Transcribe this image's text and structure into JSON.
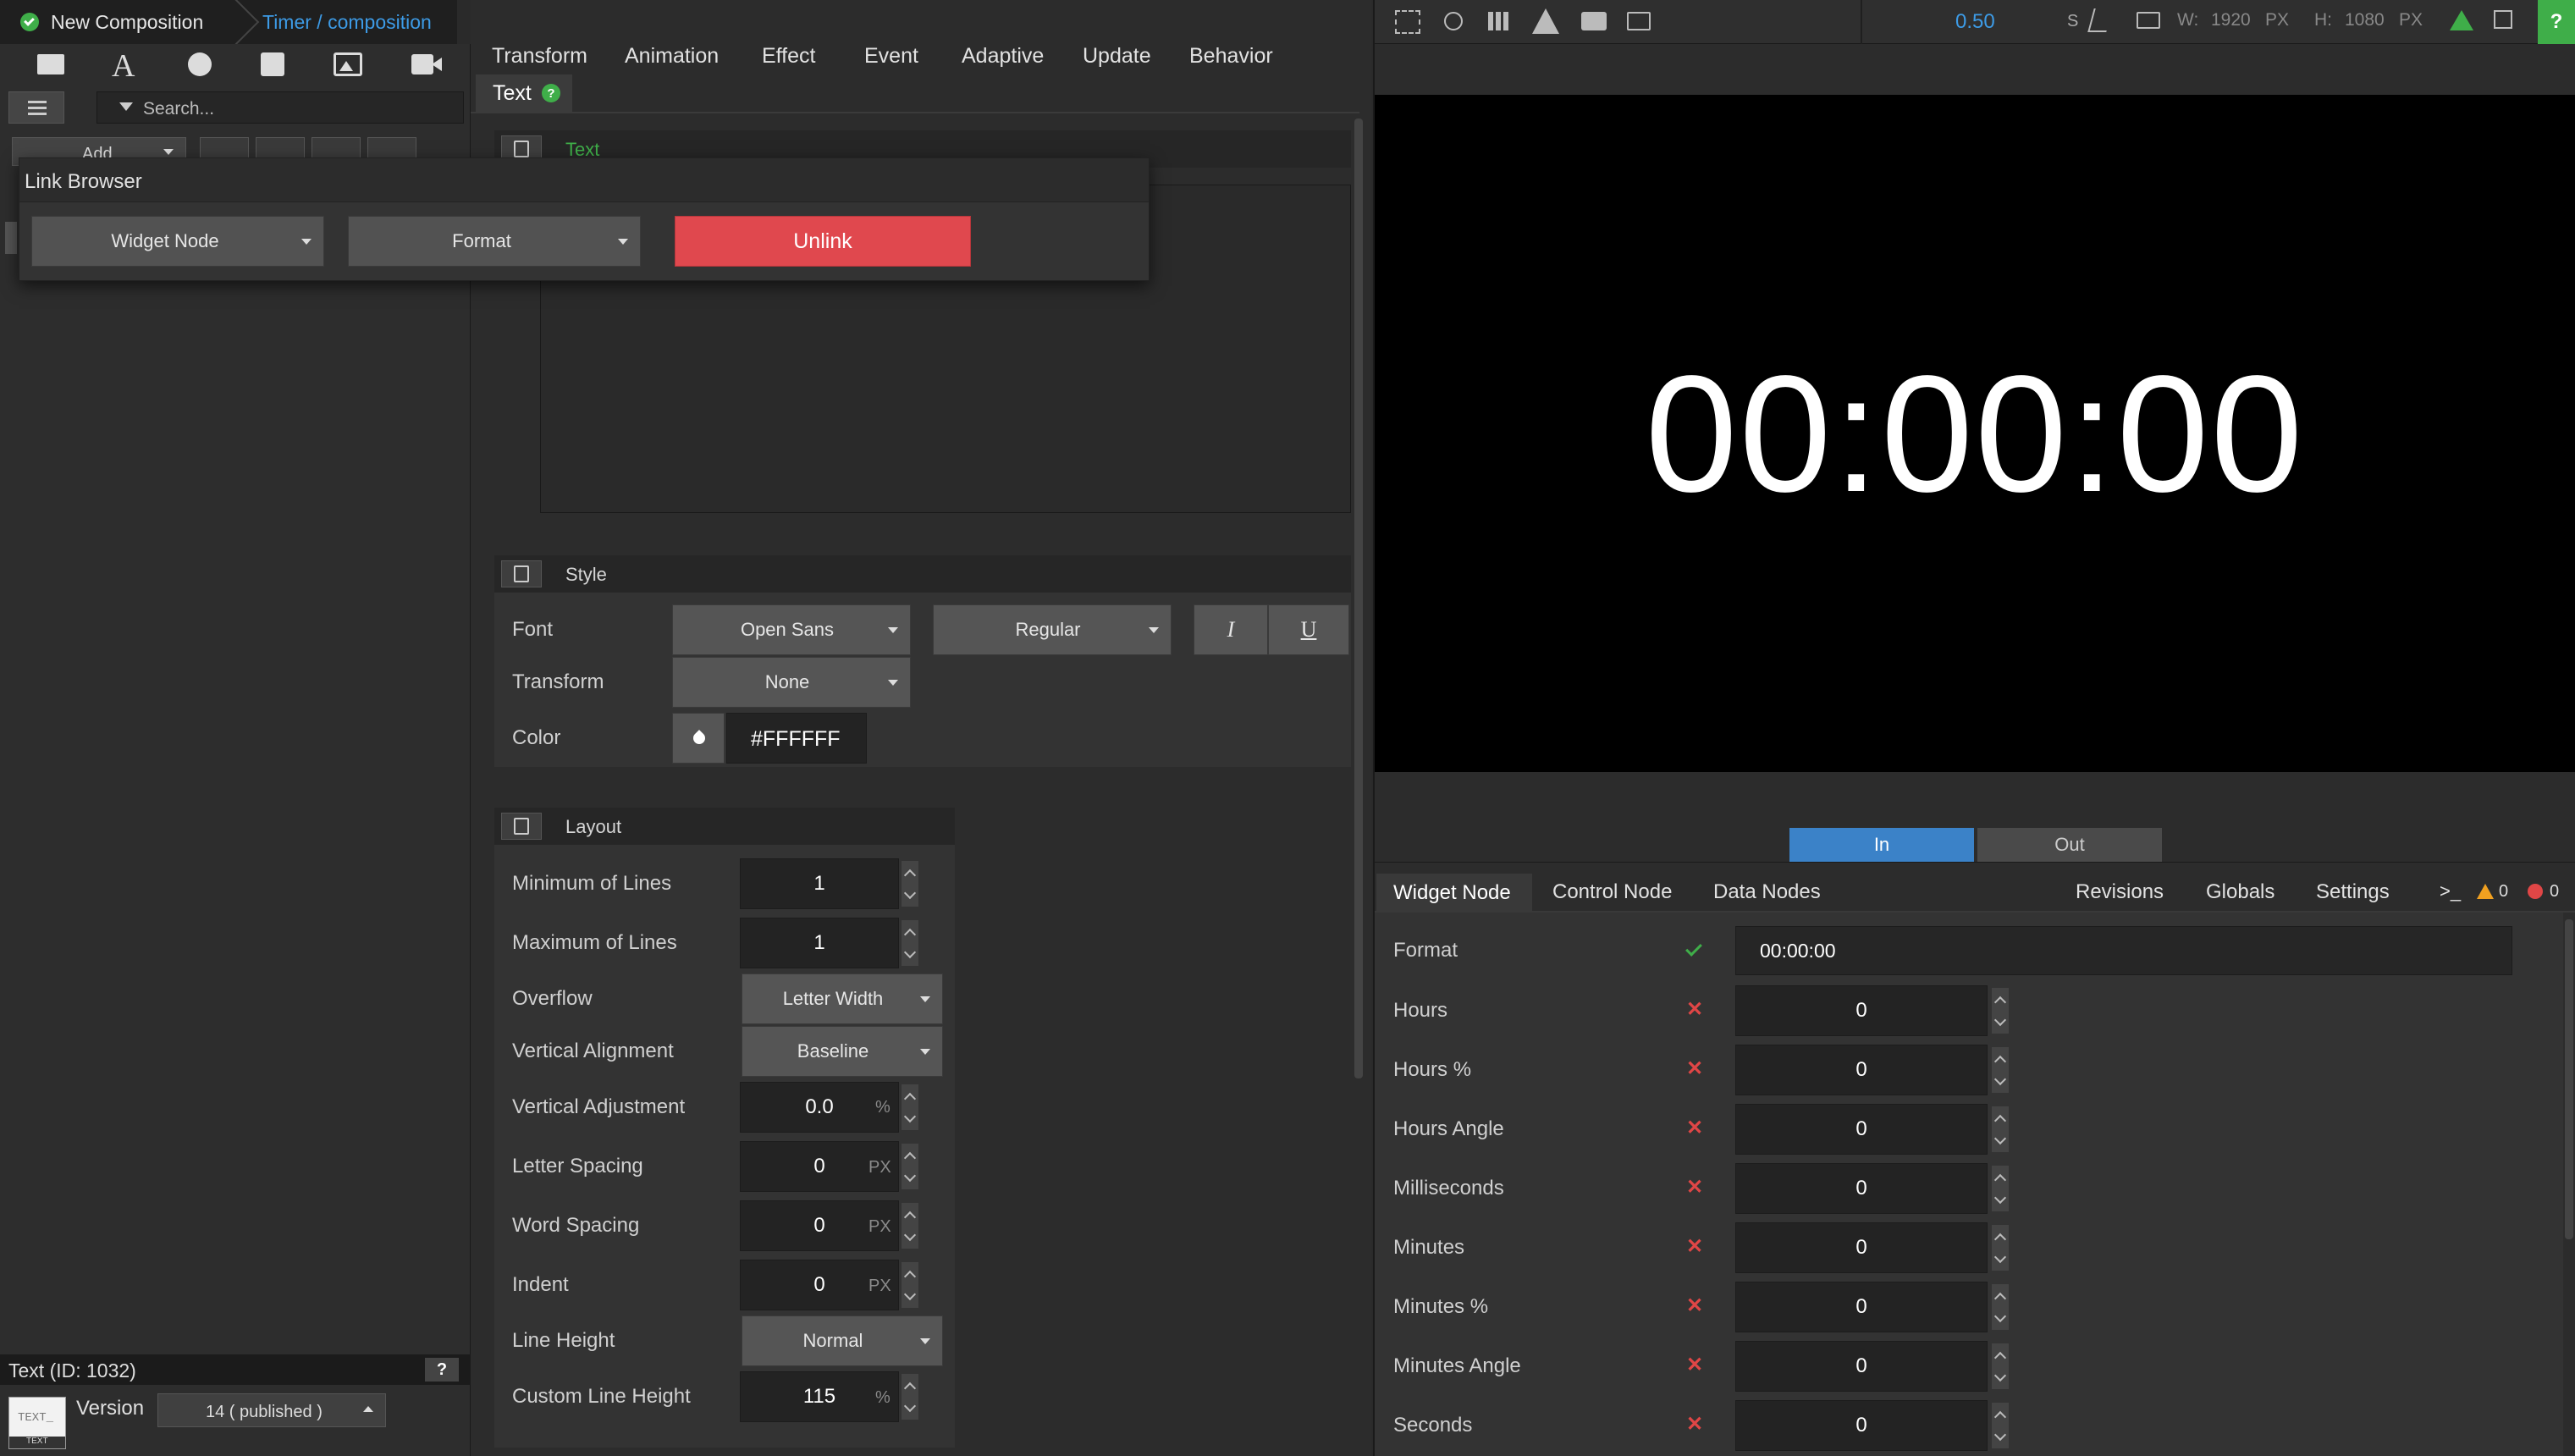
{
  "breadcrumb": {
    "root": "New Composition",
    "path": "Timer / composition"
  },
  "left": {
    "search_placeholder": "Search...",
    "add_label": "Add",
    "selected_item": "Text (ID: 1032)",
    "help": "?",
    "version_label": "Version",
    "version_value": "14 ( published )",
    "thumb_text": "TEXT_",
    "thumb_sub": "TEXT"
  },
  "link_browser": {
    "title": "Link Browser",
    "widget_node": "Widget Node",
    "format": "Format",
    "unlink": "Unlink"
  },
  "menu": [
    "Transform",
    "Animation",
    "Effect",
    "Event",
    "Adaptive",
    "Update",
    "Behavior"
  ],
  "subtab": {
    "label": "Text",
    "help": "?"
  },
  "text_section": {
    "title": "Text"
  },
  "style": {
    "title": "Style",
    "font_label": "Font",
    "font_value": "Open Sans",
    "weight_value": "Regular",
    "italic": "I",
    "underline": "U",
    "transform_label": "Transform",
    "transform_value": "None",
    "color_label": "Color",
    "color_value": "#FFFFFF"
  },
  "layout": {
    "title": "Layout",
    "rows": [
      {
        "label": "Minimum of Lines",
        "value": "1",
        "unit": ""
      },
      {
        "label": "Maximum of Lines",
        "value": "1",
        "unit": ""
      },
      {
        "label": "Overflow",
        "value": "Letter Width",
        "unit": ""
      },
      {
        "label": "Vertical Alignment",
        "value": "Baseline",
        "unit": ""
      },
      {
        "label": "Vertical Adjustment",
        "value": "0.0",
        "unit": "%"
      },
      {
        "label": "Letter Spacing",
        "value": "0",
        "unit": "PX"
      },
      {
        "label": "Word Spacing",
        "value": "0",
        "unit": "PX"
      },
      {
        "label": "Indent",
        "value": "0",
        "unit": "PX"
      },
      {
        "label": "Line Height",
        "value": "Normal",
        "unit": ""
      },
      {
        "label": "Custom Line Height",
        "value": "115",
        "unit": "%"
      }
    ]
  },
  "preview_toolbar": {
    "zoom": "0.50",
    "s_label": "S",
    "w_label": "W:",
    "w_value": "1920",
    "w_unit": "PX",
    "h_label": "H:",
    "h_value": "1080",
    "h_unit": "PX",
    "help": "?"
  },
  "preview": {
    "time": "00:00:00"
  },
  "inout": {
    "in": "In",
    "out": "Out"
  },
  "bottom_tabs": {
    "tabs": [
      "Widget Node",
      "Control Node",
      "Data Nodes"
    ],
    "right_tabs": [
      "Revisions",
      "Globals",
      "Settings"
    ],
    "console": ">_",
    "warn_count": "0",
    "err_count": "0"
  },
  "node_props": {
    "format_label": "Format",
    "format_value": "00:00:00",
    "rows": [
      {
        "label": "Hours",
        "value": "0"
      },
      {
        "label": "Hours %",
        "value": "0"
      },
      {
        "label": "Hours Angle",
        "value": "0"
      },
      {
        "label": "Milliseconds",
        "value": "0"
      },
      {
        "label": "Minutes",
        "value": "0"
      },
      {
        "label": "Minutes %",
        "value": "0"
      },
      {
        "label": "Minutes Angle",
        "value": "0"
      },
      {
        "label": "Seconds",
        "value": "0"
      }
    ]
  },
  "colors": {
    "accent": "#2a8ad4",
    "unlink": "#e0484e",
    "in_tab": "#3b82c8",
    "ok": "#3fae49",
    "err": "#e04646",
    "warn": "#f0a020"
  }
}
